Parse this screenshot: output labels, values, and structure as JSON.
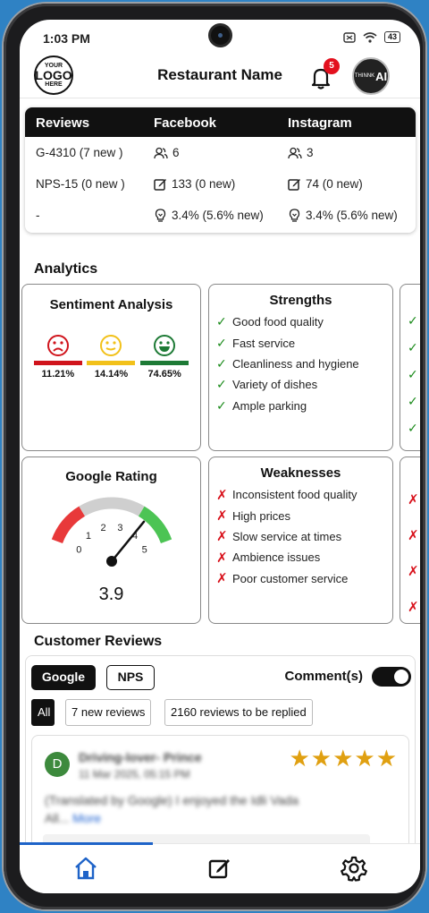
{
  "status_bar": {
    "time": "1:03 PM",
    "battery": "43"
  },
  "header": {
    "logo": {
      "line1": "YOUR",
      "line2": "LOGO",
      "line3": "HERE"
    },
    "title": "Restaurant Name",
    "notification_count": "5",
    "avatar": {
      "small": "THINNK",
      "big": "AI"
    }
  },
  "stats": {
    "headers": [
      "Reviews",
      "Facebook",
      "Instagram"
    ],
    "rows": [
      {
        "reviews": "G-4310 (7 new )",
        "facebook": "6",
        "instagram": "3",
        "icon": "people-icon"
      },
      {
        "reviews": "NPS-15 (0 new )",
        "facebook": "133 (0 new)",
        "instagram": "74 (0 new)",
        "icon": "edit-icon"
      },
      {
        "reviews": "-",
        "facebook": "3.4% (5.6% new)",
        "instagram": "3.4% (5.6% new)",
        "icon": "engagement-icon"
      }
    ]
  },
  "analytics": {
    "title": "Analytics",
    "sentiment": {
      "title": "Sentiment Analysis",
      "items": [
        {
          "label": "11.21%",
          "color": "#d0141c",
          "face": "sad"
        },
        {
          "label": "14.14%",
          "color": "#f2c11a",
          "face": "neutral"
        },
        {
          "label": "74.65%",
          "color": "#1d7a35",
          "face": "happy"
        }
      ]
    },
    "strengths": {
      "title": "Strengths",
      "items": [
        "Good food quality",
        "Fast service",
        "Cleanliness and hygiene",
        "Variety of dishes",
        "Ample parking"
      ]
    },
    "google_rating": {
      "title": "Google Rating",
      "value": "3.9",
      "rating": 3.9,
      "ticks": [
        "0",
        "1",
        "2",
        "3",
        "4",
        "5"
      ]
    },
    "weaknesses": {
      "title": "Weaknesses",
      "items": [
        "Inconsistent food quality",
        "High prices",
        "Slow service at times",
        "Ambience issues",
        "Poor customer service"
      ]
    }
  },
  "customer_reviews": {
    "title": "Customer Reviews",
    "tabs": [
      "Google",
      "NPS"
    ],
    "comments_label": "Comment(s)",
    "filters": [
      "All",
      "7 new reviews",
      "2160 reviews to be replied"
    ],
    "review": {
      "initial": "D",
      "name": "Driving-lover- Prince",
      "date": "11 Mar 2025, 05:15 PM",
      "stars": "★★★★★",
      "text": "(Translated by Google) I enjoyed the Idli Vada All...",
      "more": "More"
    }
  },
  "colors": {
    "accent": "#1e63c8",
    "check": "#1a8a1a",
    "cross": "#d8101a",
    "star": "#e0a011"
  }
}
